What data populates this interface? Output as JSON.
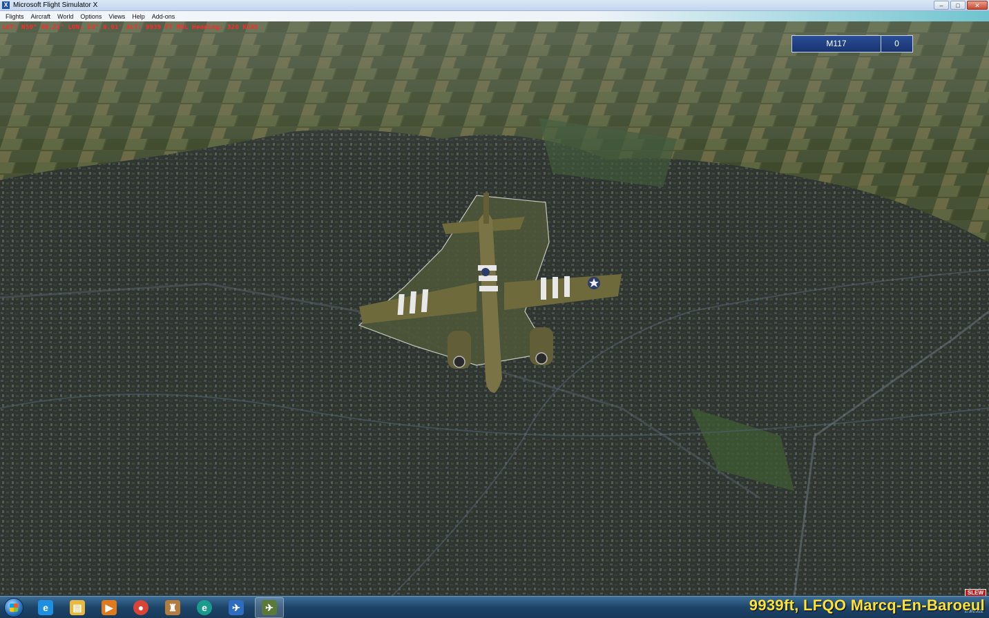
{
  "window": {
    "title": "Microsoft Flight Simulator X",
    "icon": "fsx-app-icon",
    "controls": {
      "minimize": "–",
      "maximize": "□",
      "close": "✕"
    }
  },
  "menu": [
    "Flights",
    "Aircraft",
    "World",
    "Options",
    "Views",
    "Help",
    "Add-ons"
  ],
  "hud": {
    "readout": "LAT: N50° 40.21'  LON: E3° 6.01'  ALT: 9939 FT  MSL  Heading: 320  KIAS",
    "multiplayer": {
      "name": "M117",
      "count": "0"
    },
    "slew_badge": "SLEW",
    "location_label": "9939ft, LFQO Marcq-En-Baroeul"
  },
  "taskbar": {
    "items": [
      {
        "name": "internet-explorer",
        "glyph": "e",
        "color": "#1e8fe0"
      },
      {
        "name": "file-explorer",
        "glyph": "▤",
        "color": "#e8b93c"
      },
      {
        "name": "media-player",
        "glyph": "▶",
        "color": "#e07a1e"
      },
      {
        "name": "chrome",
        "glyph": "●",
        "color": "#d94436"
      },
      {
        "name": "app-castle",
        "glyph": "♜",
        "color": "#b47b3f"
      },
      {
        "name": "edge",
        "glyph": "e",
        "color": "#1a9c8c"
      },
      {
        "name": "flight-planner",
        "glyph": "✈",
        "color": "#2e6cc2"
      },
      {
        "name": "fsx",
        "glyph": "✈",
        "color": "#5b7a3a"
      }
    ],
    "clock": "2/9/2022"
  }
}
